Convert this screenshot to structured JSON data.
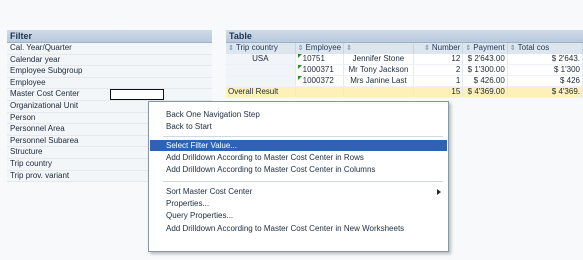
{
  "filter": {
    "title": "Filter",
    "items": [
      "Cal. Year/Quarter",
      "Calendar year",
      "Employee Subgroup",
      "Employee",
      "Master Cost Center",
      "Organizational Unit",
      "Person",
      "Personnel Area",
      "Personnel Subarea",
      "Structure",
      "Trip country",
      "Trip prov. variant"
    ]
  },
  "table": {
    "title": "Table",
    "headers": [
      "Trip country",
      "Employee",
      "",
      "Number",
      "Payment",
      "Total cos"
    ],
    "rows": [
      [
        "USA",
        "10751",
        "Jennifer Stone",
        "12",
        "$ 2'643.00",
        "$ 2'643."
      ],
      [
        "",
        "1000371",
        "Mr Tony Jackson",
        "2",
        "$ 1'300.00",
        "$ 1'300"
      ],
      [
        "",
        "1000372",
        "Mrs Janine Last",
        "1",
        "$ 426.00",
        "$ 426"
      ]
    ],
    "result_row": [
      "Overall Result",
      "",
      "",
      "15",
      "$ 4'369.00",
      "$ 4'369."
    ]
  },
  "context_menu": {
    "items": [
      "Back One Navigation Step",
      "Back to Start",
      "Select Filter Value...",
      "Add Drilldown According to Master Cost Center in Rows",
      "Add Drilldown According to Master Cost Center in Columns",
      "Sort Master Cost Center",
      "Properties...",
      "Query Properties...",
      "Add Drilldown According to Master Cost Center in New Worksheets"
    ],
    "highlighted": "Select Filter Value...",
    "colors": {
      "highlight": "#2f62b6",
      "header": "#b9c9dc",
      "result": "#fdf1b8"
    }
  }
}
